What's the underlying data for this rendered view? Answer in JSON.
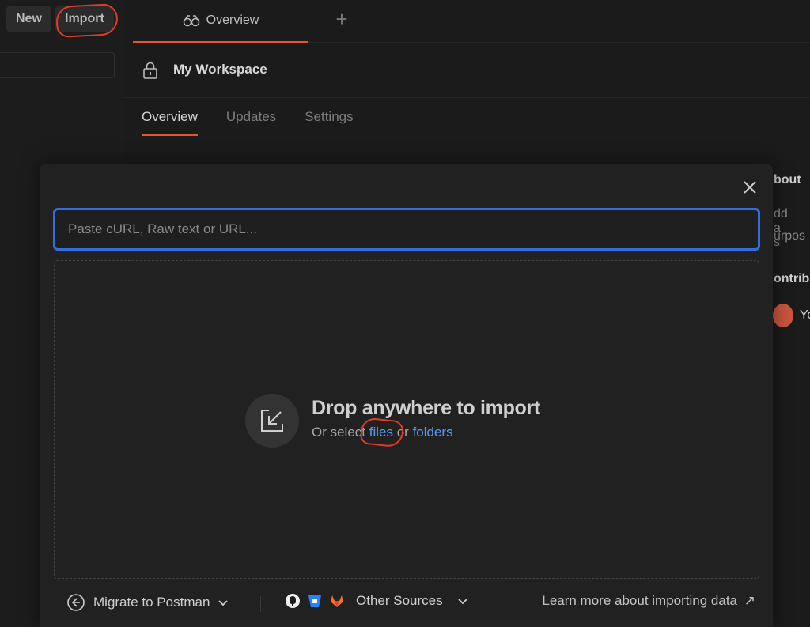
{
  "sidebar": {
    "new_label": "New",
    "import_label": "Import"
  },
  "tabs": {
    "overview_label": "Overview",
    "plus_label": "+"
  },
  "workspace": {
    "title": "My Workspace",
    "tabs": [
      {
        "label": "Overview"
      },
      {
        "label": "Updates"
      },
      {
        "label": "Settings"
      }
    ]
  },
  "right_peek": {
    "about": "bout",
    "add": "dd a s",
    "purpose": "urpos",
    "contrib": "ontrib",
    "you": "Yo"
  },
  "modal": {
    "input_placeholder": "Paste cURL, Raw text or URL...",
    "drop_title": "Drop anywhere to import",
    "drop_sub_prefix": "Or select ",
    "files_link": "files",
    "drop_sub_mid": " or ",
    "folders_link": "folders",
    "migrate_label": "Migrate to Postman",
    "other_sources_label": "Other Sources",
    "learn_prefix": "Learn more about ",
    "learn_link": "importing data",
    "learn_arrow": "↗"
  },
  "colors": {
    "accent_orange": "#e0582b",
    "focus_blue": "#2f6fe0",
    "link_blue": "#5a9bf0",
    "annotation_red": "#e03c28"
  }
}
